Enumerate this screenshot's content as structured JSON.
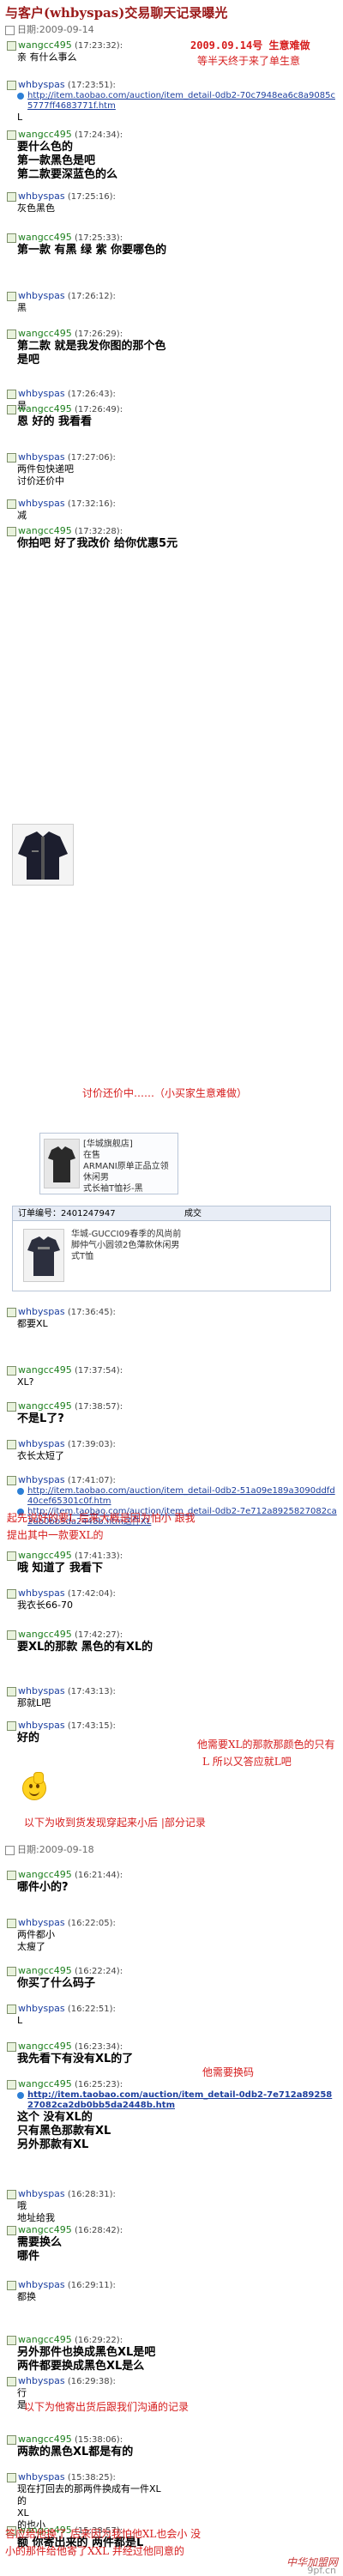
{
  "title": "与客户(whbyspas)交易聊天记录曝光",
  "dates": [
    "日期:2009-09-14",
    "日期:2009-09-18"
  ],
  "seller": "whbyspas",
  "customer": "wangcc495",
  "messages": [
    {
      "sender": "wangcc495",
      "time": "(17:23:32):",
      "lines": [
        "亲 有什么事么"
      ]
    },
    {
      "sender": "whbyspas",
      "time": "(17:23:51):",
      "link": "http://item.taobao.com/auction/item_detail-0db2-70c7948ea6c8a9085c5777ff4683771f.htm",
      "after": "L"
    },
    {
      "sender": "wangcc495",
      "time": "(17:24:34):",
      "lines": [
        "要什么色的",
        "第一款黑色是吧",
        "第二款要深蓝色的么"
      ],
      "big": true
    },
    {
      "sender": "whbyspas",
      "time": "(17:25:16):",
      "lines": [
        "灰色黑色"
      ]
    },
    {
      "sender": "wangcc495",
      "time": "(17:25:33):",
      "lines": [
        "第一款 有黑 绿 紫 你要哪色的"
      ],
      "big": true
    },
    {
      "sender": "whbyspas",
      "time": "(17:26:12):",
      "lines": [
        "黑"
      ]
    },
    {
      "sender": "wangcc495",
      "time": "(17:26:29):",
      "lines": [
        "第二款 就是我发你图的那个色",
        "是吧"
      ],
      "big": true
    },
    {
      "sender": "whbyspas",
      "time": "(17:26:43):",
      "lines": [
        "是"
      ]
    },
    {
      "sender": "wangcc495",
      "time": "(17:26:49):",
      "lines": [
        "恩 好的 我看看"
      ],
      "big": true
    },
    {
      "sender": "whbyspas",
      "time": "(17:27:06):",
      "lines": [
        "两件包快递吧",
        "讨价还价中"
      ]
    },
    {
      "sender": "whbyspas",
      "time": "(17:32:16):",
      "lines": [
        "减"
      ]
    },
    {
      "sender": "wangcc495",
      "time": "(17:32:28):",
      "lines": [
        "你拍吧 好了我改价 给你优惠5元"
      ],
      "big": true
    },
    {
      "sender": "whbyspas",
      "time": "(17:36:45):",
      "lines": [
        "都要XL"
      ]
    },
    {
      "sender": "wangcc495",
      "time": "(17:37:54):",
      "lines": [
        "XL?"
      ]
    },
    {
      "sender": "wangcc495",
      "time": "(17:38:57):",
      "lines": [
        "不是L了?"
      ],
      "big": true
    },
    {
      "sender": "whbyspas",
      "time": "(17:39:03):",
      "lines": [
        "衣长太短了"
      ]
    },
    {
      "sender": "whbyspas",
      "time": "(17:41:07):",
      "links": [
        "http://item.taobao.com/auction/item_detail-0db2-51a09e189a3090ddfd40cef65301c0f.htm",
        "http://item.taobao.com/auction/item_detail-0db2-7e712a8925827082ca2db0bb5da2448b.htm这件XL"
      ]
    },
    {
      "sender": "wangcc495",
      "time": "(17:41:33):",
      "lines": [
        "哦 知道了 我看下"
      ],
      "big": true
    },
    {
      "sender": "whbyspas",
      "time": "(17:42:04):",
      "lines": [
        "我衣长66-70"
      ]
    },
    {
      "sender": "wangcc495",
      "time": "(17:42:27):",
      "lines": [
        "要XL的那款 黑色的有XL的"
      ],
      "big": true
    },
    {
      "sender": "whbyspas",
      "time": "(17:43:13):",
      "lines": [
        "那就L吧"
      ]
    },
    {
      "sender": "whbyspas",
      "time": "(17:43:15):",
      "lines": [
        "好的"
      ],
      "big": true
    },
    {
      "sender": "wangcc495",
      "time": "(16:21:44):",
      "lines": [
        "哪件小的?"
      ],
      "big": true
    },
    {
      "sender": "whbyspas",
      "time": "(16:22:05):",
      "lines": [
        "两件都小",
        "太瘦了"
      ]
    },
    {
      "sender": "wangcc495",
      "time": "(16:22:24):",
      "lines": [
        "你买了什么码子"
      ],
      "big": true
    },
    {
      "sender": "whbyspas",
      "time": "(16:22:51):",
      "lines": [
        "L"
      ]
    },
    {
      "sender": "wangcc495",
      "time": "(16:23:34):",
      "lines": [
        "我先看下有没有XL的了"
      ],
      "big": true
    },
    {
      "sender": "wangcc495",
      "time": "(16:25:23):",
      "link": "http://item.taobao.com/auction/item_detail-0db2-7e712a8925827082ca2db0bb5da2448b.htm",
      "lines": [
        "这个 没有XL的",
        "只有黑色那款有XL",
        "另外那款有XL"
      ],
      "big": true
    },
    {
      "sender": "whbyspas",
      "time": "(16:28:31):",
      "lines": [
        "哦",
        "地址给我"
      ]
    },
    {
      "sender": "wangcc495",
      "time": "(16:28:42):",
      "lines": [
        "需要换么",
        "哪件"
      ],
      "big": true
    },
    {
      "sender": "whbyspas",
      "time": "(16:29:11):",
      "lines": [
        "都换"
      ]
    },
    {
      "sender": "wangcc495",
      "time": "(16:29:22):",
      "lines": [
        "另外那件也换成黑色XL是吧",
        "两件都要换成黑色XL是么"
      ],
      "big": true
    },
    {
      "sender": "whbyspas",
      "time": "(16:29:38):",
      "lines": [
        "行",
        "是"
      ]
    },
    {
      "sender": "wangcc495",
      "time": "(15:38:06):",
      "lines": [
        "两款的黑色XL都是有的"
      ],
      "big": true
    },
    {
      "sender": "whbyspas",
      "time": "(15:38:25):",
      "lines": [
        "现在打回去的那两件换成有一件XL",
        "的",
        "XL",
        "的也小"
      ]
    },
    {
      "sender": "wangcc495",
      "time": "(15:38:57):",
      "lines": [
        "额 你寄出来的 两件都是L"
      ],
      "big": true
    },
    {
      "sender": "whbyspas",
      "time": "(15:39:13):",
      "lines": [
        ""
      ]
    }
  ],
  "annotations": {
    "date_note": "2009.09.14号 生意难做",
    "date_note2": "等半天终于来了单生意",
    "bargain": "讨价还价中……（小买家生意难做）",
    "note1": "起先说好的要L 后来大概是因为怕小 跟我",
    "note2": "提出其中一款要XL的",
    "note3": "他需要XL的那款那颜色的只有",
    "note4": "L 所以又答应就L吧",
    "note5": "以下为收到货发现穿起来小后 |部分记录",
    "note6": "他需要换码",
    "note7": "以下为他寄出货后跟我们沟通的记录",
    "note8": "答应给他换了 后来因为我怕他XL也会小 没",
    "note9": "小的那件给他寄了XXL 并经过他同意的"
  },
  "product_cards": [
    {
      "title": "[华城旗舰店]",
      "line2": "在售",
      "line3": "ARMANI原单正品立领休闲男",
      "line4": "式长袖T恤衫-黑"
    },
    {
      "order": "订单编号：2401247947",
      "status": "成交",
      "title": "华城-GUCCI09春季的风尚前",
      "line2": "脚仲气小圆领2色薄款休闲男",
      "line3": "式T恤"
    }
  ],
  "watermark": "中华加盟网",
  "watermark2": "9pf.cn"
}
